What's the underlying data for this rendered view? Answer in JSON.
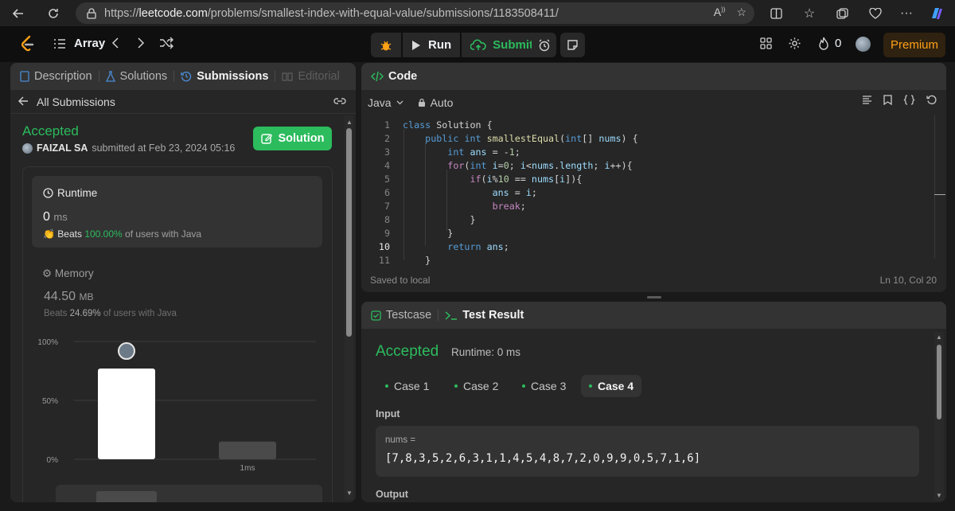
{
  "browser": {
    "url_prefix": "https://",
    "url_host": "leetcode.com",
    "url_path": "/problems/smallest-index-with-equal-value/submissions/1183508411/"
  },
  "nav": {
    "list_label": "Array",
    "run_label": "Run",
    "submit_label": "Submit",
    "streak_count": "0",
    "premium_label": "Premium"
  },
  "left": {
    "tabs": [
      "Description",
      "Solutions",
      "Submissions",
      "Editorial"
    ],
    "back_label": "All Submissions",
    "status": "Accepted",
    "submitter_name": "FAIZAL SA",
    "submitted_text": "submitted at Feb 23, 2024 05:16",
    "solution_label": "Solution",
    "runtime": {
      "label": "Runtime",
      "value": "0",
      "unit": "ms",
      "beats_prefix": "Beats",
      "beats_pct": "100.00%",
      "beats_suffix": "of users with Java"
    },
    "memory": {
      "label": "Memory",
      "value": "44.50",
      "unit": "MB",
      "beats_prefix": "Beats",
      "beats_pct": "24.69%",
      "beats_suffix": "of users with Java"
    }
  },
  "chart_data": {
    "type": "bar",
    "categories": [
      "0ms",
      "1ms"
    ],
    "values": [
      77,
      15
    ],
    "x_tick_labels": [
      "",
      "1ms"
    ],
    "y_ticks": [
      "100%",
      "50%",
      "0%"
    ],
    "ylim": [
      0,
      100
    ],
    "highlight_index": 0,
    "colors": [
      "#ffffff",
      "#4a4a4a"
    ]
  },
  "code": {
    "title": "Code",
    "language": "Java",
    "mode": "Auto",
    "saved": "Saved to local",
    "position": "Ln 10, Col 20",
    "current_line": 10,
    "lines": [
      "class Solution {",
      "    public int smallestEqual(int[] nums) {",
      "        int ans = -1;",
      "        for(int i=0; i<nums.length; i++){",
      "            if(i%10 == nums[i]){",
      "                ans = i;",
      "                break;",
      "            }",
      "        }",
      "        return ans;",
      "    }"
    ]
  },
  "result": {
    "tab_testcase": "Testcase",
    "tab_result": "Test Result",
    "status": "Accepted",
    "runtime": "Runtime: 0 ms",
    "cases": [
      "Case 1",
      "Case 2",
      "Case 3",
      "Case 4"
    ],
    "active_case": 3,
    "input_label": "Input",
    "input_name": "nums =",
    "input_value": "[7,8,3,5,2,6,3,1,1,4,5,4,8,7,2,0,9,9,0,5,7,1,6]",
    "output_label": "Output"
  }
}
